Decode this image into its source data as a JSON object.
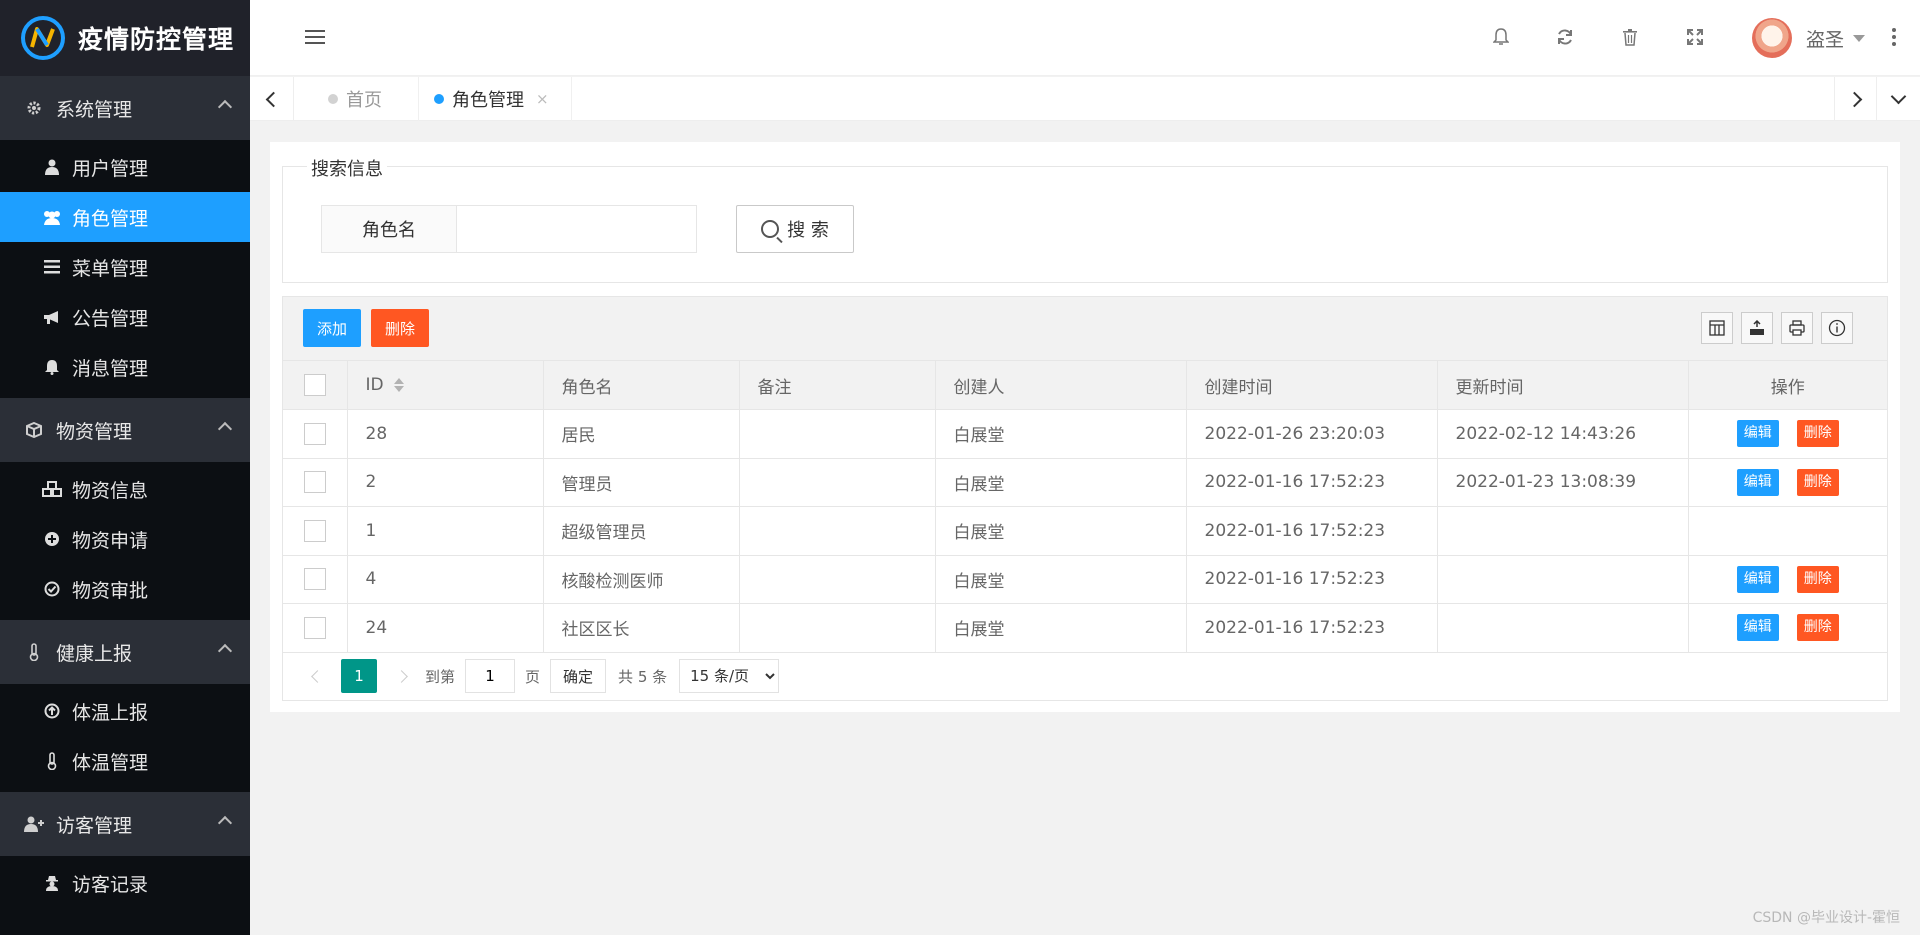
{
  "app": {
    "title": "疫情防控管理",
    "brand_colors": {
      "blue": "#1e9fff",
      "orange": "#ff5722",
      "teal": "#009688"
    }
  },
  "sidebar": {
    "groups": [
      {
        "label": "系统管理",
        "icon": "gear-icon",
        "items": [
          {
            "label": "用户管理",
            "icon": "user-icon"
          },
          {
            "label": "角色管理",
            "icon": "users-icon",
            "active": true
          },
          {
            "label": "菜单管理",
            "icon": "bars-icon"
          },
          {
            "label": "公告管理",
            "icon": "bullhorn-icon"
          },
          {
            "label": "消息管理",
            "icon": "bell-icon"
          }
        ]
      },
      {
        "label": "物资管理",
        "icon": "cube-icon",
        "items": [
          {
            "label": "物资信息",
            "icon": "cubes-icon"
          },
          {
            "label": "物资申请",
            "icon": "plus-circle-icon"
          },
          {
            "label": "物资审批",
            "icon": "check-circle-icon"
          }
        ]
      },
      {
        "label": "健康上报",
        "icon": "thermometer-icon",
        "items": [
          {
            "label": "体温上报",
            "icon": "arrow-circle-up-icon"
          },
          {
            "label": "体温管理",
            "icon": "thermometer-icon"
          }
        ]
      },
      {
        "label": "访客管理",
        "icon": "user-plus-icon",
        "items": [
          {
            "label": "访客记录",
            "icon": "user-secret-icon"
          }
        ]
      }
    ]
  },
  "header": {
    "username": "盗圣"
  },
  "tabs": [
    {
      "label": "首页",
      "active": false
    },
    {
      "label": "角色管理",
      "active": true,
      "close": "×"
    }
  ],
  "search": {
    "legend": "搜索信息",
    "label": "角色名",
    "value": "",
    "placeholder": "",
    "button": "搜 索"
  },
  "toolbar": {
    "add": "添加",
    "delete": "删除"
  },
  "table": {
    "columns": [
      "ID",
      "角色名",
      "备注",
      "创建人",
      "创建时间",
      "更新时间",
      "操作"
    ],
    "rows": [
      {
        "id": "28",
        "name": "居民",
        "remark": "",
        "creator": "白展堂",
        "created": "2022-01-26 23:20:03",
        "updated": "2022-02-12 14:43:26",
        "actions": true
      },
      {
        "id": "2",
        "name": "管理员",
        "remark": "",
        "creator": "白展堂",
        "created": "2022-01-16 17:52:23",
        "updated": "2022-01-23 13:08:39",
        "actions": true
      },
      {
        "id": "1",
        "name": "超级管理员",
        "remark": "",
        "creator": "白展堂",
        "created": "2022-01-16 17:52:23",
        "updated": "",
        "actions": false
      },
      {
        "id": "4",
        "name": "核酸检测医师",
        "remark": "",
        "creator": "白展堂",
        "created": "2022-01-16 17:52:23",
        "updated": "",
        "actions": true
      },
      {
        "id": "24",
        "name": "社区区长",
        "remark": "",
        "creator": "白展堂",
        "created": "2022-01-16 17:52:23",
        "updated": "",
        "actions": true
      }
    ],
    "action_edit": "编辑",
    "action_delete": "删除"
  },
  "pager": {
    "current": "1",
    "goto_label": "到第",
    "goto_value": "1",
    "page_unit": "页",
    "confirm": "确定",
    "total": "共 5 条",
    "page_size": "15 条/页"
  },
  "watermark": "CSDN @毕业设计-霍恒"
}
